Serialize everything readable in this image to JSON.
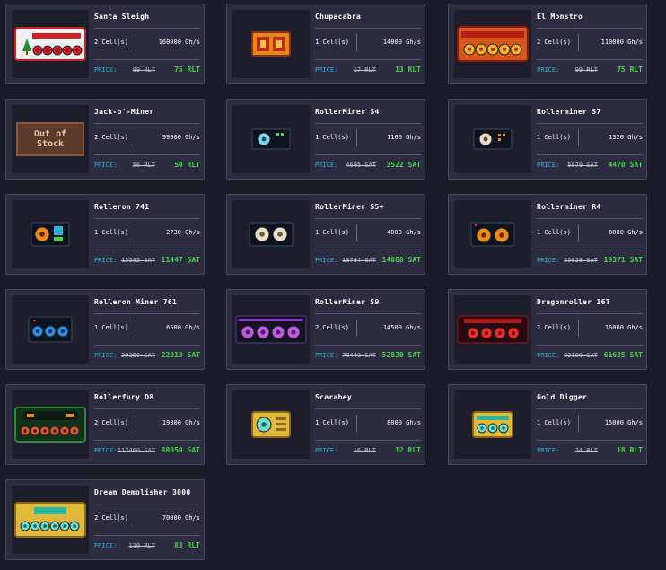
{
  "labels": {
    "price": "PRICE:"
  },
  "colors": {
    "background": "#1c1b29",
    "card": "#2c2b3f",
    "price_label": "#28b7d6",
    "new_price": "#47d54a"
  },
  "miners": [
    {
      "name": "Santa Sleigh",
      "cells": "2 Cell(s)",
      "power": "160000 Gh/s",
      "old_price": "99 RLT",
      "new_price": "75 RLT",
      "icon": "santa-sleigh-miner-icon"
    },
    {
      "name": "Chupacabra",
      "cells": "1 Cell(s)",
      "power": "14000 Gh/s",
      "old_price": "17 RLT",
      "new_price": "13 RLT",
      "icon": "chupacabra-miner-icon"
    },
    {
      "name": "El Monstro",
      "cells": "2 Cell(s)",
      "power": "110000 Gh/s",
      "old_price": "99 RLT",
      "new_price": "75 RLT",
      "icon": "el-monstro-miner-icon"
    },
    {
      "name": "Jack-o'-Miner",
      "cells": "2 Cell(s)",
      "power": "99900 Gh/s",
      "old_price": "56 RLT",
      "new_price": "50 RLT",
      "icon": "out-of-stock-icon",
      "out_of_stock": "Out of Stock"
    },
    {
      "name": "RollerMiner S4",
      "cells": "1 Cell(s)",
      "power": "1160 Gh/s",
      "old_price": "4695 SAT",
      "new_price": "3522 SAT",
      "icon": "rollerminer-s4-icon"
    },
    {
      "name": "Rollerminer S7",
      "cells": "1 Cell(s)",
      "power": "1320 Gh/s",
      "old_price": "5970 SAT",
      "new_price": "4470 SAT",
      "icon": "rollerminer-s7-icon"
    },
    {
      "name": "Rolleron 741",
      "cells": "1 Cell(s)",
      "power": "2730 Gh/s",
      "old_price": "15262 SAT",
      "new_price": "11447 SAT",
      "icon": "rolleron-741-icon"
    },
    {
      "name": "RollerMiner S5+",
      "cells": "1 Cell(s)",
      "power": "4000 Gh/s",
      "old_price": "18784 SAT",
      "new_price": "14088 SAT",
      "icon": "rollerminer-s5plus-icon"
    },
    {
      "name": "Rollerminer R4",
      "cells": "1 Cell(s)",
      "power": "6000 Gh/s",
      "old_price": "25828 SAT",
      "new_price": "19371 SAT",
      "icon": "rollerminer-r4-icon"
    },
    {
      "name": "Rolleron Miner 761",
      "cells": "1 Cell(s)",
      "power": "6500 Gh/s",
      "old_price": "29350 SAT",
      "new_price": "22013 SAT",
      "icon": "rolleron-miner-761-icon"
    },
    {
      "name": "RollerMiner S9",
      "cells": "2 Cell(s)",
      "power": "14500 Gh/s",
      "old_price": "70440 SAT",
      "new_price": "52830 SAT",
      "icon": "rollerminer-s9-icon"
    },
    {
      "name": "Dragonroller 16T",
      "cells": "2 Cell(s)",
      "power": "16000 Gh/s",
      "old_price": "82180 SAT",
      "new_price": "61635 SAT",
      "icon": "dragonroller-16t-icon"
    },
    {
      "name": "Rollerfury D8",
      "cells": "2 Cell(s)",
      "power": "19300 Gh/s",
      "old_price": "117400 SAT",
      "new_price": "88050 SAT",
      "icon": "rollerfury-d8-icon"
    },
    {
      "name": "Scarabey",
      "cells": "1 Cell(s)",
      "power": "8000 Gh/s",
      "old_price": "16 RLT",
      "new_price": "12 RLT",
      "icon": "scarabey-miner-icon"
    },
    {
      "name": "Gold Digger",
      "cells": "1 Cell(s)",
      "power": "15000 Gh/s",
      "old_price": "24 RLT",
      "new_price": "18 RLT",
      "icon": "gold-digger-miner-icon"
    },
    {
      "name": "Dream Demolisher 3000",
      "cells": "2 Cell(s)",
      "power": "70000 Gh/s",
      "old_price": "110 RLT",
      "new_price": "83 RLT",
      "icon": "dream-demolisher-icon"
    }
  ]
}
